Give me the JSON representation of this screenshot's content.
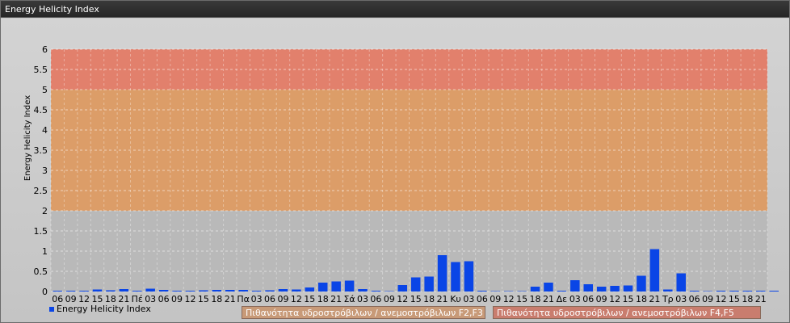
{
  "window": {
    "title": "Energy Helicity Index"
  },
  "legend": {
    "series_label": "Energy Helicity Index"
  },
  "zones": {
    "zone1_label": "Πιθανότητα υδροστρόβιλων / ανεμοστρόβιλων F2,F3",
    "zone2_label": "Πιθανότητα υδροστρόβιλων / ανεμοστρόβιλων F4,F5"
  },
  "colors": {
    "bar": "#0a45e6",
    "band_low": "#b9b9b9",
    "band_mid": "#dc9d68",
    "band_high": "#e2806c"
  },
  "chart_data": {
    "type": "bar",
    "ylabel": "Energy Helicity Index",
    "xlabel": "",
    "title": "",
    "ylim": [
      0,
      6
    ],
    "yticks": [
      "0",
      "0.5",
      "1",
      "1.5",
      "2",
      "2.5",
      "3",
      "3.5",
      "4",
      "4.5",
      "5",
      "5.5",
      "6"
    ],
    "grid": true,
    "legend_position": "bottom-left",
    "bands": [
      {
        "from": 0,
        "to": 2,
        "color": "#b9b9b9"
      },
      {
        "from": 2,
        "to": 5,
        "color": "#dc9d68"
      },
      {
        "from": 5,
        "to": 6,
        "color": "#e2806c"
      }
    ],
    "categories": [
      "06",
      "09",
      "12",
      "15",
      "18",
      "21",
      "Πέ",
      "03",
      "06",
      "09",
      "12",
      "15",
      "18",
      "21",
      "Πα",
      "03",
      "06",
      "09",
      "12",
      "15",
      "18",
      "21",
      "Σά",
      "03",
      "06",
      "09",
      "12",
      "15",
      "18",
      "21",
      "Κυ",
      "03",
      "06",
      "09",
      "12",
      "15",
      "18",
      "21",
      "Δε",
      "03",
      "06",
      "09",
      "12",
      "15",
      "18",
      "21",
      "Τρ",
      "03",
      "06",
      "09",
      "12",
      "15",
      "18",
      "21"
    ],
    "series": [
      {
        "name": "Energy Helicity Index",
        "values": [
          0.02,
          0.02,
          0.02,
          0.05,
          0.03,
          0.06,
          0.02,
          0.07,
          0.04,
          0.02,
          0.02,
          0.03,
          0.04,
          0.04,
          0.04,
          0.02,
          0.03,
          0.06,
          0.05,
          0.1,
          0.22,
          0.25,
          0.27,
          0.06,
          0.02,
          0.01,
          0.16,
          0.35,
          0.37,
          0.9,
          0.73,
          0.75,
          0.02,
          0.01,
          0.01,
          0.01,
          0.12,
          0.22,
          0.02,
          0.28,
          0.18,
          0.12,
          0.14,
          0.15,
          0.39,
          1.05,
          0.05,
          0.45,
          0.02,
          0.01,
          0.02,
          0.02,
          0.02,
          0.02,
          0.02
        ]
      }
    ]
  }
}
